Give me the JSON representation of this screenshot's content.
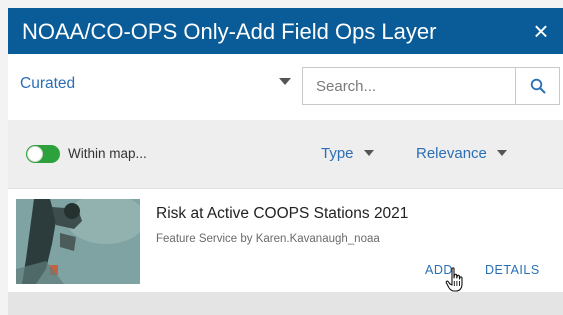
{
  "window": {
    "title": "NOAA/CO-OPS Only-Add Field Ops Layer",
    "close_glyph": "×"
  },
  "filter": {
    "source_label": "Curated",
    "search_placeholder": "Search..."
  },
  "options": {
    "within_map_label": "Within map...",
    "within_map_enabled": true,
    "type_label": "Type",
    "relevance_label": "Relevance"
  },
  "results": [
    {
      "title": "Risk at Active COOPS Stations 2021",
      "subtitle": "Feature Service by Karen.Kavanaugh_noaa",
      "add_label": "ADD",
      "details_label": "DETAILS"
    }
  ],
  "colors": {
    "header_bg": "#0a5c98",
    "link_blue": "#2a6fb6",
    "toggle_on": "#2da13b"
  },
  "icons": {
    "close": "close-icon",
    "search": "search-icon",
    "dropdown": "caret-down-icon",
    "cursor": "hand-pointer-icon"
  }
}
